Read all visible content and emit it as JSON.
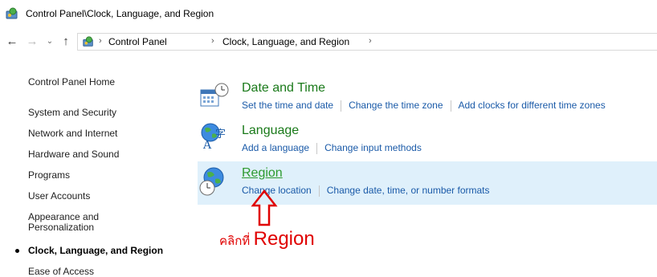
{
  "window": {
    "title": "Control Panel\\Clock, Language, and Region"
  },
  "address_bar": {
    "crumbs": [
      "Control Panel",
      "Clock, Language, and Region"
    ]
  },
  "sidebar": {
    "home": "Control Panel Home",
    "items": [
      "System and Security",
      "Network and Internet",
      "Hardware and Sound",
      "Programs",
      "User Accounts",
      "Appearance and Personalization",
      "Clock, Language, and Region",
      "Ease of Access"
    ]
  },
  "categories": [
    {
      "title": "Date and Time",
      "links": [
        "Set the time and date",
        "Change the time zone",
        "Add clocks for different time zones"
      ]
    },
    {
      "title": "Language",
      "links": [
        "Add a language",
        "Change input methods"
      ]
    },
    {
      "title": "Region",
      "links": [
        "Change location",
        "Change date, time, or number formats"
      ]
    }
  ],
  "annotation": {
    "thai": "คลิกที่",
    "english": "Region",
    "color": "#e00000"
  },
  "colors": {
    "link": "#1a5aa8",
    "category_title": "#1a7a1a",
    "highlight": "#dff0fb"
  }
}
